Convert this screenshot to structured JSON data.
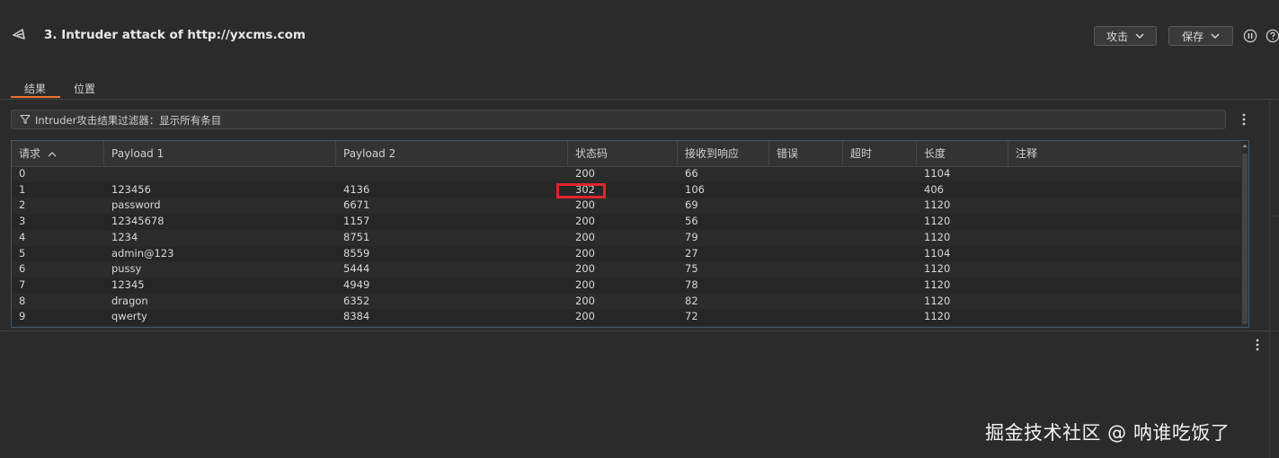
{
  "window": {
    "title": "3. Intruder attack of http://yxcms.com"
  },
  "toolbar": {
    "attack_label": "攻击",
    "save_label": "保存"
  },
  "tabs": [
    {
      "label": "结果"
    },
    {
      "label": "位置"
    }
  ],
  "filter": {
    "text": "Intruder攻击结果过滤器：显示所有条目"
  },
  "table": {
    "columns": [
      "请求",
      "Payload 1",
      "Payload 2",
      "状态码",
      "接收到响应",
      "错误",
      "超时",
      "长度",
      "注释"
    ],
    "rows": [
      [
        "0",
        "",
        "",
        "200",
        "66",
        "",
        "",
        "1104",
        ""
      ],
      [
        "1",
        "123456",
        "4136",
        "302",
        "106",
        "",
        "",
        "406",
        ""
      ],
      [
        "2",
        "password",
        "6671",
        "200",
        "69",
        "",
        "",
        "1120",
        ""
      ],
      [
        "3",
        "12345678",
        "1157",
        "200",
        "56",
        "",
        "",
        "1120",
        ""
      ],
      [
        "4",
        "1234",
        "8751",
        "200",
        "79",
        "",
        "",
        "1120",
        ""
      ],
      [
        "5",
        "admin@123",
        "8559",
        "200",
        "27",
        "",
        "",
        "1104",
        ""
      ],
      [
        "6",
        "pussy",
        "5444",
        "200",
        "75",
        "",
        "",
        "1120",
        ""
      ],
      [
        "7",
        "12345",
        "4949",
        "200",
        "78",
        "",
        "",
        "1120",
        ""
      ],
      [
        "8",
        "dragon",
        "6352",
        "200",
        "82",
        "",
        "",
        "1120",
        ""
      ],
      [
        "9",
        "qwerty",
        "8384",
        "200",
        "72",
        "",
        "",
        "1120",
        ""
      ]
    ],
    "sorted_column": "请求",
    "highlighted_cell": {
      "row": 1,
      "column": "状态码"
    }
  },
  "watermark": "掘金技术社区 @ 呐谁吃饭了",
  "colors": {
    "accent": "#e8742b",
    "highlight": "#e0242b",
    "background": "#2b2b2b"
  },
  "icons": [
    "burp-app-icon",
    "chevron-down-icon",
    "pause-icon",
    "help-icon",
    "filter-icon",
    "kebab-menu-icon",
    "sort-ascending-icon"
  ]
}
